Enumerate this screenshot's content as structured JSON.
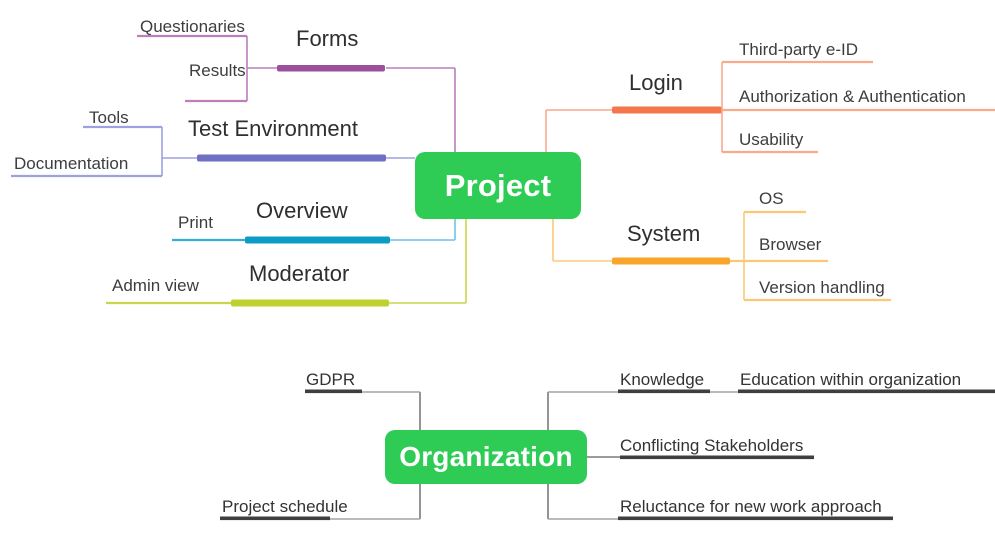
{
  "diagram": {
    "type": "mind-map",
    "background": "#ffffff",
    "root_nodes": [
      {
        "id": "project",
        "label": "Project",
        "color": "#2ECC55"
      },
      {
        "id": "organization",
        "label": "Organization",
        "color": "#2ECC55"
      }
    ]
  },
  "project": {
    "label": "Project",
    "color": "#2ECC55",
    "branches": [
      {
        "id": "forms",
        "label": "Forms",
        "color": "#A855A8",
        "bar_color": "#9C4F9C",
        "side": "left",
        "children": [
          {
            "label": "Questionaries"
          },
          {
            "label": "Results"
          }
        ]
      },
      {
        "id": "test-environment",
        "label": "Test Environment",
        "color": "#8E8FD4",
        "bar_color": "#6F70C4",
        "side": "left",
        "children": [
          {
            "label": "Tools"
          },
          {
            "label": "Documentation"
          }
        ]
      },
      {
        "id": "overview",
        "label": "Overview",
        "color": "#39ABDB",
        "bar_color": "#0D9BC8",
        "side": "left",
        "children": [
          {
            "label": "Print"
          }
        ]
      },
      {
        "id": "moderator",
        "label": "Moderator",
        "color": "#C3D03A",
        "bar_color": "#BFD130",
        "side": "left",
        "children": [
          {
            "label": "Admin view"
          }
        ]
      },
      {
        "id": "login",
        "label": "Login",
        "color": "#F98C6B",
        "bar_color": "#F4774B",
        "side": "right",
        "children": [
          {
            "label": "Third-party e-ID"
          },
          {
            "label": "Authorization & Authentication"
          },
          {
            "label": "Usability"
          }
        ]
      },
      {
        "id": "system",
        "label": "System",
        "color": "#FBBF62",
        "bar_color": "#F9A52B",
        "side": "right",
        "children": [
          {
            "label": "OS"
          },
          {
            "label": "Browser"
          },
          {
            "label": "Version handling"
          }
        ]
      }
    ]
  },
  "organization": {
    "label": "Organization",
    "color": "#2ECC55",
    "line_color": "#6E6E6E",
    "bar_color": "#404040",
    "branches": [
      {
        "id": "gdpr",
        "label": "GDPR",
        "side": "left",
        "children": []
      },
      {
        "id": "project-schedule",
        "label": "Project schedule",
        "side": "left",
        "children": []
      },
      {
        "id": "knowledge",
        "label": "Knowledge",
        "side": "right",
        "children": [
          {
            "label": "Education within organization"
          }
        ]
      },
      {
        "id": "conflicting-stakeholders",
        "label": "Conflicting Stakeholders",
        "side": "right",
        "children": []
      },
      {
        "id": "reluctance",
        "label": "Reluctance for new work approach",
        "side": "right",
        "children": []
      }
    ]
  }
}
